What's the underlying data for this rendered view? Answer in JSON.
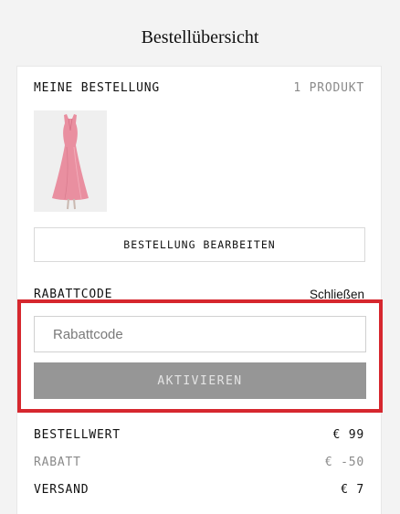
{
  "page": {
    "title": "Bestellübersicht"
  },
  "order": {
    "heading": "MEINE BESTELLUNG",
    "count": "1 PRODUKT",
    "edit_button": "BESTELLUNG BEARBEITEN"
  },
  "coupon": {
    "heading": "RABATTCODE",
    "close_link": "Schließen",
    "input_placeholder": "Rabattcode",
    "input_value": "",
    "activate_button": "AKTIVIEREN"
  },
  "summary": {
    "order_value_label": "BESTELLWERT",
    "order_value": "€ 99",
    "discount_label": "RABATT",
    "discount_value": "€ -50",
    "shipping_label": "VERSAND",
    "shipping_value": "€ 7"
  },
  "colors": {
    "highlight": "#d6272e",
    "activate_button_bg": "#969696",
    "dress": "#e98fa0"
  }
}
